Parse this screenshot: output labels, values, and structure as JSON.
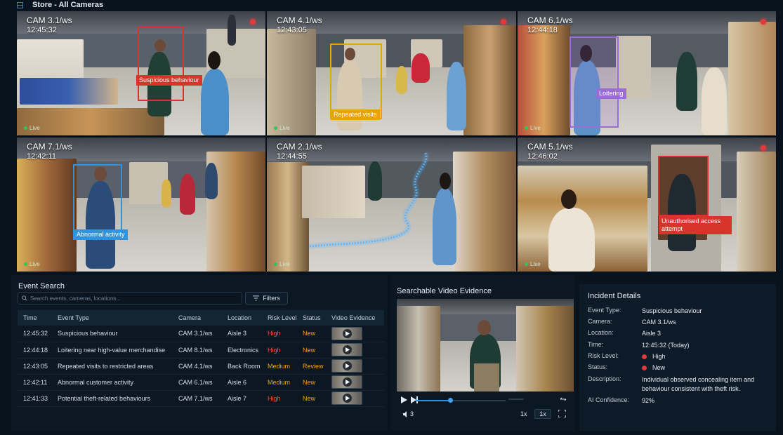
{
  "header": {
    "title": "Store - All Cameras"
  },
  "colors": {
    "red": "#d9342b",
    "amber": "#e8a30c",
    "purple": "#9b6bd8",
    "blue": "#2f93dd",
    "high": "#ff4a3d",
    "medium": "#f2a20e",
    "new": "#f2a20e"
  },
  "cameras": [
    {
      "name": "CAM 3.1/ws",
      "time": "12:45:32",
      "live": "Live",
      "alert": "Suspicious behaviour"
    },
    {
      "name": "CAM 4.1/ws",
      "time": "12:43:05",
      "live": "Live",
      "alert": "Repeated visits"
    },
    {
      "name": "CAM 6.1/ws",
      "time": "12:44:18",
      "live": "Live",
      "alert": "Loitering"
    },
    {
      "name": "CAM 7.1/ws",
      "time": "12:42:11",
      "live": "Live",
      "alert": "Abnormal activity"
    },
    {
      "name": "CAM 2.1/ws",
      "time": "12:44:55",
      "live": "Live",
      "alert": ""
    },
    {
      "name": "CAM 5.1/ws",
      "time": "12:46:02",
      "live": "Live",
      "alert": "Unauthorised access attempt"
    }
  ],
  "event_search": {
    "title": "Event Search",
    "placeholder": "Search events, cameras, locations...",
    "filters_label": "Filters",
    "columns": [
      "Time",
      "Event Type",
      "Camera",
      "Location",
      "Risk Level",
      "Status",
      "Video Evidence"
    ],
    "rows": [
      {
        "time": "12:45:32",
        "event": "Suspicious behaviour",
        "camera": "CAM 3.1/ws",
        "location": "Aisle 3",
        "risk": "High",
        "status": "New"
      },
      {
        "time": "12:44:18",
        "event": "Loitering near high-value merchandise",
        "camera": "CAM 8.1/ws",
        "location": "Electronics",
        "risk": "High",
        "status": "New"
      },
      {
        "time": "12:43:05",
        "event": "Repeated visits to restricted areas",
        "camera": "CAM 4.1/ws",
        "location": "Back Room",
        "risk": "Medium",
        "status": "Review"
      },
      {
        "time": "12:42:11",
        "event": "Abnormal customer activity",
        "camera": "CAM 6.1/ws",
        "location": "Aisle 6",
        "risk": "Medium",
        "status": "New"
      },
      {
        "time": "12:41:33",
        "event": "Potential theft-related behaviours",
        "camera": "CAM 7.1/ws",
        "location": "Aisle 7",
        "risk": "High",
        "status": "New"
      }
    ]
  },
  "video_evidence": {
    "title": "Searchable Video Evidence",
    "progress": 0.38,
    "speed_label": "1x",
    "speed_button": "1x",
    "volume_label": "3"
  },
  "incident": {
    "title": "Incident Details",
    "fields": [
      {
        "label": "Event Type:",
        "value": "Suspicious behaviour"
      },
      {
        "label": "Camera:",
        "value": "CAM 3.1/ws"
      },
      {
        "label": "Location:",
        "value": "Aisle 3"
      },
      {
        "label": "Time:",
        "value": "12:45:32 (Today)"
      },
      {
        "label": "Risk Level:",
        "value": "High"
      },
      {
        "label": "Status:",
        "value": "New"
      },
      {
        "label": "Description:",
        "value": "Individual observed concealing item and behaviour consistent with theft risk."
      },
      {
        "label": "AI Confidence:",
        "value": "92%"
      }
    ]
  }
}
